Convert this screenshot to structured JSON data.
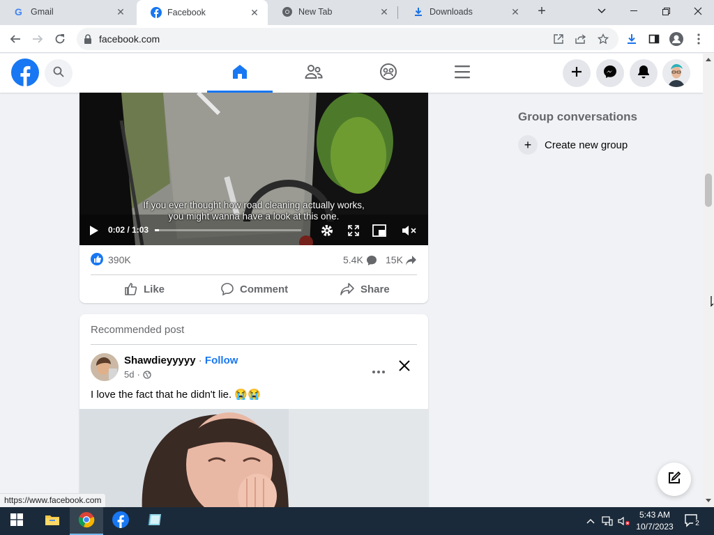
{
  "browser": {
    "tabs": [
      {
        "title": "Gmail",
        "icon": "gmail-icon",
        "active": false
      },
      {
        "title": "Facebook",
        "icon": "facebook-icon",
        "active": true
      },
      {
        "title": "New Tab",
        "icon": "chrome-icon",
        "active": false
      },
      {
        "title": "Downloads",
        "icon": "download-icon",
        "active": false
      }
    ],
    "url": "facebook.com",
    "status_url": "https://www.facebook.com"
  },
  "facebook": {
    "brand_color": "#1877f2",
    "nav": [
      "home",
      "friends",
      "groups",
      "menu"
    ],
    "active_nav": "home"
  },
  "video_post": {
    "caption": "If you ever thought how road cleaning actually works, you might wanna have a look at this one.",
    "time": "0:02 / 1:03",
    "progress_fraction": 0.03,
    "likes": "390K",
    "comments": "5.4K",
    "shares": "15K",
    "actions": {
      "like": "Like",
      "comment": "Comment",
      "share": "Share"
    }
  },
  "recommended_post": {
    "label": "Recommended post",
    "author": "Shawdieyyyyy",
    "follow": "Follow",
    "age": "5d",
    "text": "I love the fact that he didn't lie. 😭😭"
  },
  "sidebar": {
    "group_title": "Group conversations",
    "create_group": "Create new group"
  },
  "taskbar": {
    "time": "5:43 AM",
    "date": "10/7/2023",
    "notifications": "2"
  }
}
